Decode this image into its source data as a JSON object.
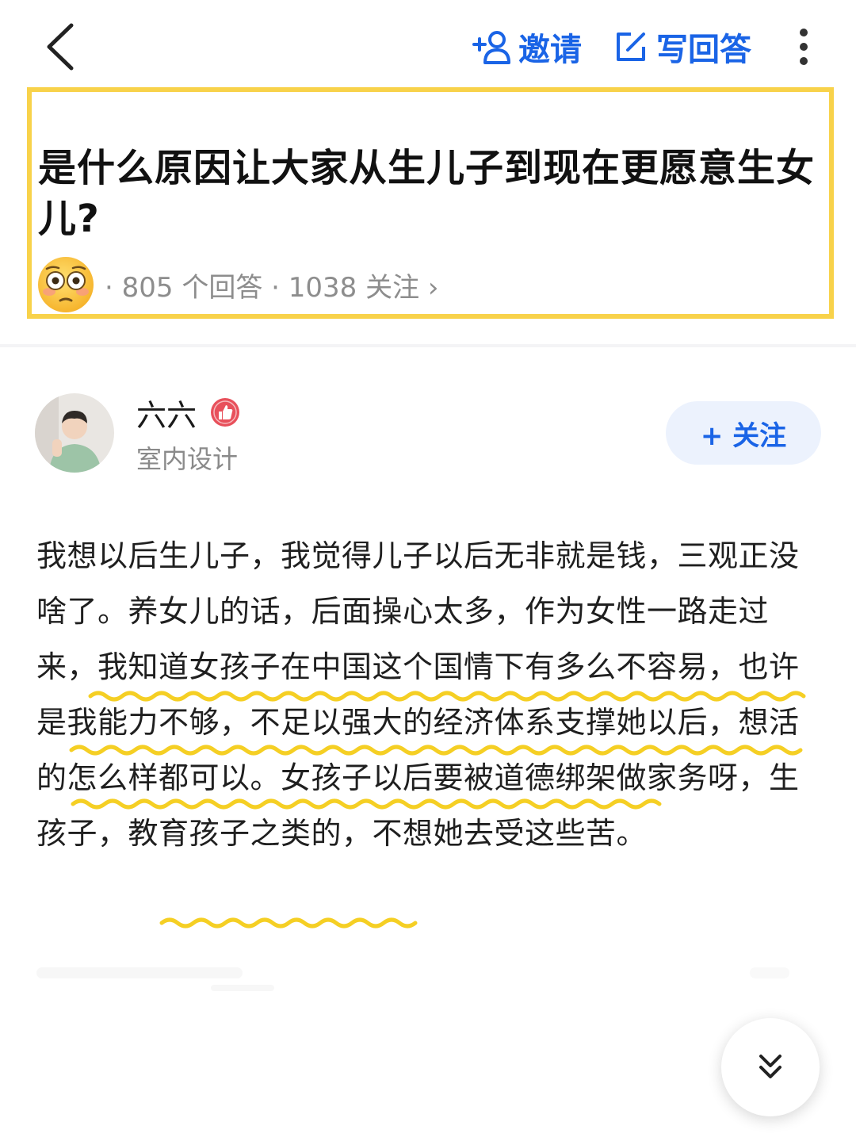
{
  "header": {
    "invite_label": "邀请",
    "write_answer_label": "写回答",
    "accent_color": "#1a64e6"
  },
  "question": {
    "title": "是什么原因让大家从生儿子到现在更愿意生女儿?",
    "meta": "· 805 个回答 · 1038 关注 ›",
    "highlight_color": "#f8d24a"
  },
  "author": {
    "name": "六六",
    "description": "室内设计",
    "follow_label": "+ 关注"
  },
  "answer": {
    "text": "我想以后生儿子，我觉得儿子以后无非就是钱，三观正没啥了。养女儿的话，后面操心太多，作为女性一路走过来，我知道女孩子在中国这个国情下有多么不容易，也许是我能力不够，不足以强大的经济体系支撑她以后，想活的怎么样都可以。女孩子以后要被道德绑架做家务呀，生孩子，教育孩子之类的，不想她去受这些苦。",
    "underline_color": "#f5cf24"
  },
  "icons": {
    "back": "chevron-left-icon",
    "invite": "add-person-icon",
    "write": "edit-icon",
    "more": "more-vertical-icon",
    "scroll": "double-chevron-down-icon"
  }
}
